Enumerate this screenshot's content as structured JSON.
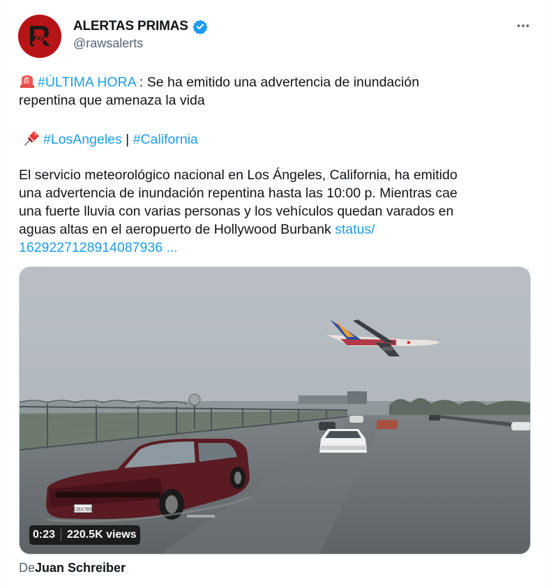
{
  "author": {
    "name": "ALERTAS PRIMAS",
    "handle": "@rawsalerts",
    "verified": true
  },
  "tweet": {
    "line1_tag": "#ÚLTIMA HORA",
    "line1_text": " : Se ha emitido una advertencia de inundación",
    "line2": "repentina que amenaza la vida",
    "tag_losangeles": "#LosAngeles",
    "tag_sep": " | ",
    "tag_california": "#California",
    "body_lines": [
      "El servicio meteorológico nacional en Los Ángeles, California, ha emitido",
      "una advertencia de inundación repentina hasta las 10:00 p. Mientras cae",
      "una fuerte lluvia con varias personas y los vehículos quedan varados en"
    ],
    "body_line4": "aguas altas en el aeropuerto de Hollywood Burbank ",
    "link_part1": "status/",
    "link_part2": "1629227128914087936 ..."
  },
  "media": {
    "duration": "0:23",
    "views": "220.5K views",
    "license_plate": "CBX7B5"
  },
  "credit": {
    "prefix": "De",
    "name": "Juan Schreiber"
  },
  "icons": {
    "alert": "police-light-icon",
    "pin": "pushpin-icon",
    "verified": "verified-badge-icon",
    "more": "more-icon"
  },
  "colors": {
    "link": "#1d9bf0",
    "secondary_text": "#536471",
    "avatar_bg": "#b71418"
  }
}
